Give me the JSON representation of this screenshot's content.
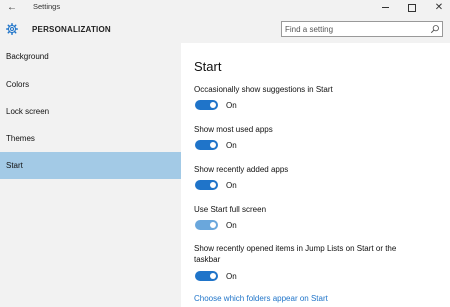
{
  "window": {
    "title": "Settings",
    "back_glyph": "←",
    "minimize_icon": "minimize-icon",
    "maximize_icon": "maximize-icon",
    "close_glyph": "✕"
  },
  "header": {
    "title": "PERSONALIZATION",
    "icon": "gear-icon",
    "search_placeholder": "Find a setting"
  },
  "sidebar": {
    "items": [
      {
        "label": "Background",
        "selected": false
      },
      {
        "label": "Colors",
        "selected": false
      },
      {
        "label": "Lock screen",
        "selected": false
      },
      {
        "label": "Themes",
        "selected": false
      },
      {
        "label": "Start",
        "selected": true
      }
    ]
  },
  "main": {
    "title": "Start",
    "settings": [
      {
        "label": "Occasionally show suggestions in Start",
        "state": "On"
      },
      {
        "label": "Show most used apps",
        "state": "On"
      },
      {
        "label": "Show recently added apps",
        "state": "On"
      },
      {
        "label": "Use Start full screen",
        "state": "On"
      },
      {
        "label": "Show recently opened items in Jump Lists on Start or the taskbar",
        "state": "On"
      }
    ],
    "link": "Choose which folders appear on Start"
  },
  "colors": {
    "accent": "#1f74c9",
    "selected_nav": "#a3cae6",
    "chrome": "#f2f2f2"
  }
}
